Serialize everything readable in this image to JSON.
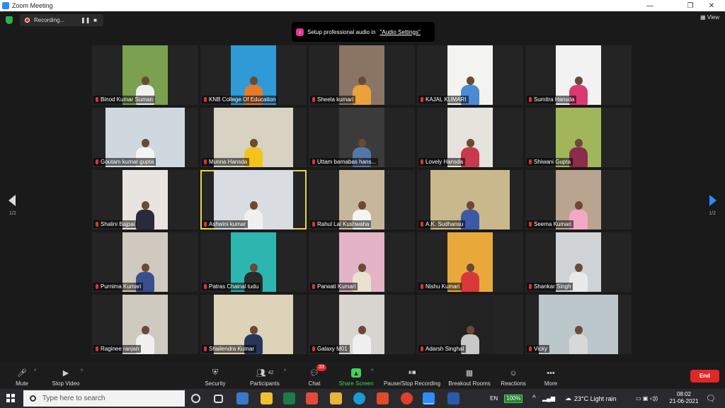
{
  "window": {
    "title": "Zoom Meeting",
    "minimize": "—",
    "maximize": "❐",
    "close": "✕"
  },
  "recording": {
    "label": "Recording...",
    "pause": "❚❚",
    "stop": "■"
  },
  "banner": {
    "text": "Setup professional audio in",
    "link": "\"Audio Settings\""
  },
  "view": {
    "label": "View"
  },
  "pagination": {
    "left": "1/2",
    "right": "1/2"
  },
  "participants": [
    {
      "name": "Binod Kumar Suman",
      "bg": "#7aa050",
      "shirt": "#f0f0f0"
    },
    {
      "name": "KNB College Of Education",
      "bg": "#2f9ad6",
      "shirt": "#e47a2a"
    },
    {
      "name": "Sheela kumari",
      "bg": "#8a7565",
      "shirt": "#e9a33a"
    },
    {
      "name": "KAJAL KUMARI",
      "bg": "#f3f3f0",
      "shirt": "#4a8bd3"
    },
    {
      "name": "Sumitra Hansda",
      "bg": "#f2f2f2",
      "shirt": "#d93a73"
    },
    {
      "name": "Goutam kumar gupta",
      "bg": "#cfd8df",
      "shirt": "#f5f5f5"
    },
    {
      "name": "Munna Hansda",
      "bg": "#d8d2c2",
      "shirt": "#f2c41a"
    },
    {
      "name": "Uttam barnabas hans...",
      "bg": "#3b3b3b",
      "shirt": "#5577a8"
    },
    {
      "name": "Lovely Hansda",
      "bg": "#e6e2dc",
      "shirt": "#c73a4c"
    },
    {
      "name": "Shiwani Gupta",
      "bg": "#a1b65a",
      "shirt": "#8a2c4a"
    },
    {
      "name": "Shalini Bajpai",
      "bg": "#e9e4df",
      "shirt": "#2a2a3a"
    },
    {
      "name": "Ashwini kumar",
      "bg": "#d9dde2",
      "shirt": "#f0f0f0"
    },
    {
      "name": "Rahul Lal Kushwaha",
      "bg": "#c7b79a",
      "shirt": "#f4f4f4"
    },
    {
      "name": "A.K. Sudhansu",
      "bg": "#c9b88b",
      "shirt": "#3e58a8"
    },
    {
      "name": "Seema Kumari",
      "bg": "#b9a48f",
      "shirt": "#f3a8c6"
    },
    {
      "name": "Purnima Kumari",
      "bg": "#d0c9c0",
      "shirt": "#3a4f8f"
    },
    {
      "name": "Patras Chainal tudu",
      "bg": "#2db6b0",
      "shirt": "#2a2a2a"
    },
    {
      "name": "Parwati Kumari",
      "bg": "#e3b3c6",
      "shirt": "#e9e2cf"
    },
    {
      "name": "Nishu Kumari",
      "bg": "#e9a93a",
      "shirt": "#d9383a"
    },
    {
      "name": "Shankar Singh",
      "bg": "#cfd3d5",
      "shirt": "#e9e9e9"
    },
    {
      "name": "Raginee ranjan",
      "bg": "#cfcabf",
      "shirt": "#f0f0f0"
    },
    {
      "name": "Shailendra Kumar",
      "bg": "#ddd3b8",
      "shirt": "#283658"
    },
    {
      "name": "Galaxy M01",
      "bg": "#d8d4cf",
      "shirt": "#f0f0f0"
    },
    {
      "name": "Adarsh Singhal",
      "bg": "#222222",
      "shirt": "#c8c8c8"
    },
    {
      "name": "Vicky",
      "bg": "#bcc7cc",
      "shirt": "#d8d8d8"
    }
  ],
  "toolbar": {
    "mute": "Mute",
    "stop_video": "Stop Video",
    "security": "Security",
    "participants": "Participants",
    "participants_count": "42",
    "chat": "Chat",
    "chat_badge": "33",
    "share_screen": "Share Screen",
    "recording": "Pause/Stop Recording",
    "breakout": "Breakout Rooms",
    "reactions": "Reactions",
    "more": "More",
    "end": "End"
  },
  "taskbar": {
    "search_placeholder": "Type here to search",
    "lang": "EN",
    "battery": "100%",
    "weather": "23°C  Light rain",
    "time": "08:02",
    "date": "21-06-2021"
  },
  "colors": {
    "accent_green": "#2fb24c",
    "end_red": "#e02828",
    "active_speaker": "#e4d93a",
    "nav_blue": "#2d8cff"
  }
}
